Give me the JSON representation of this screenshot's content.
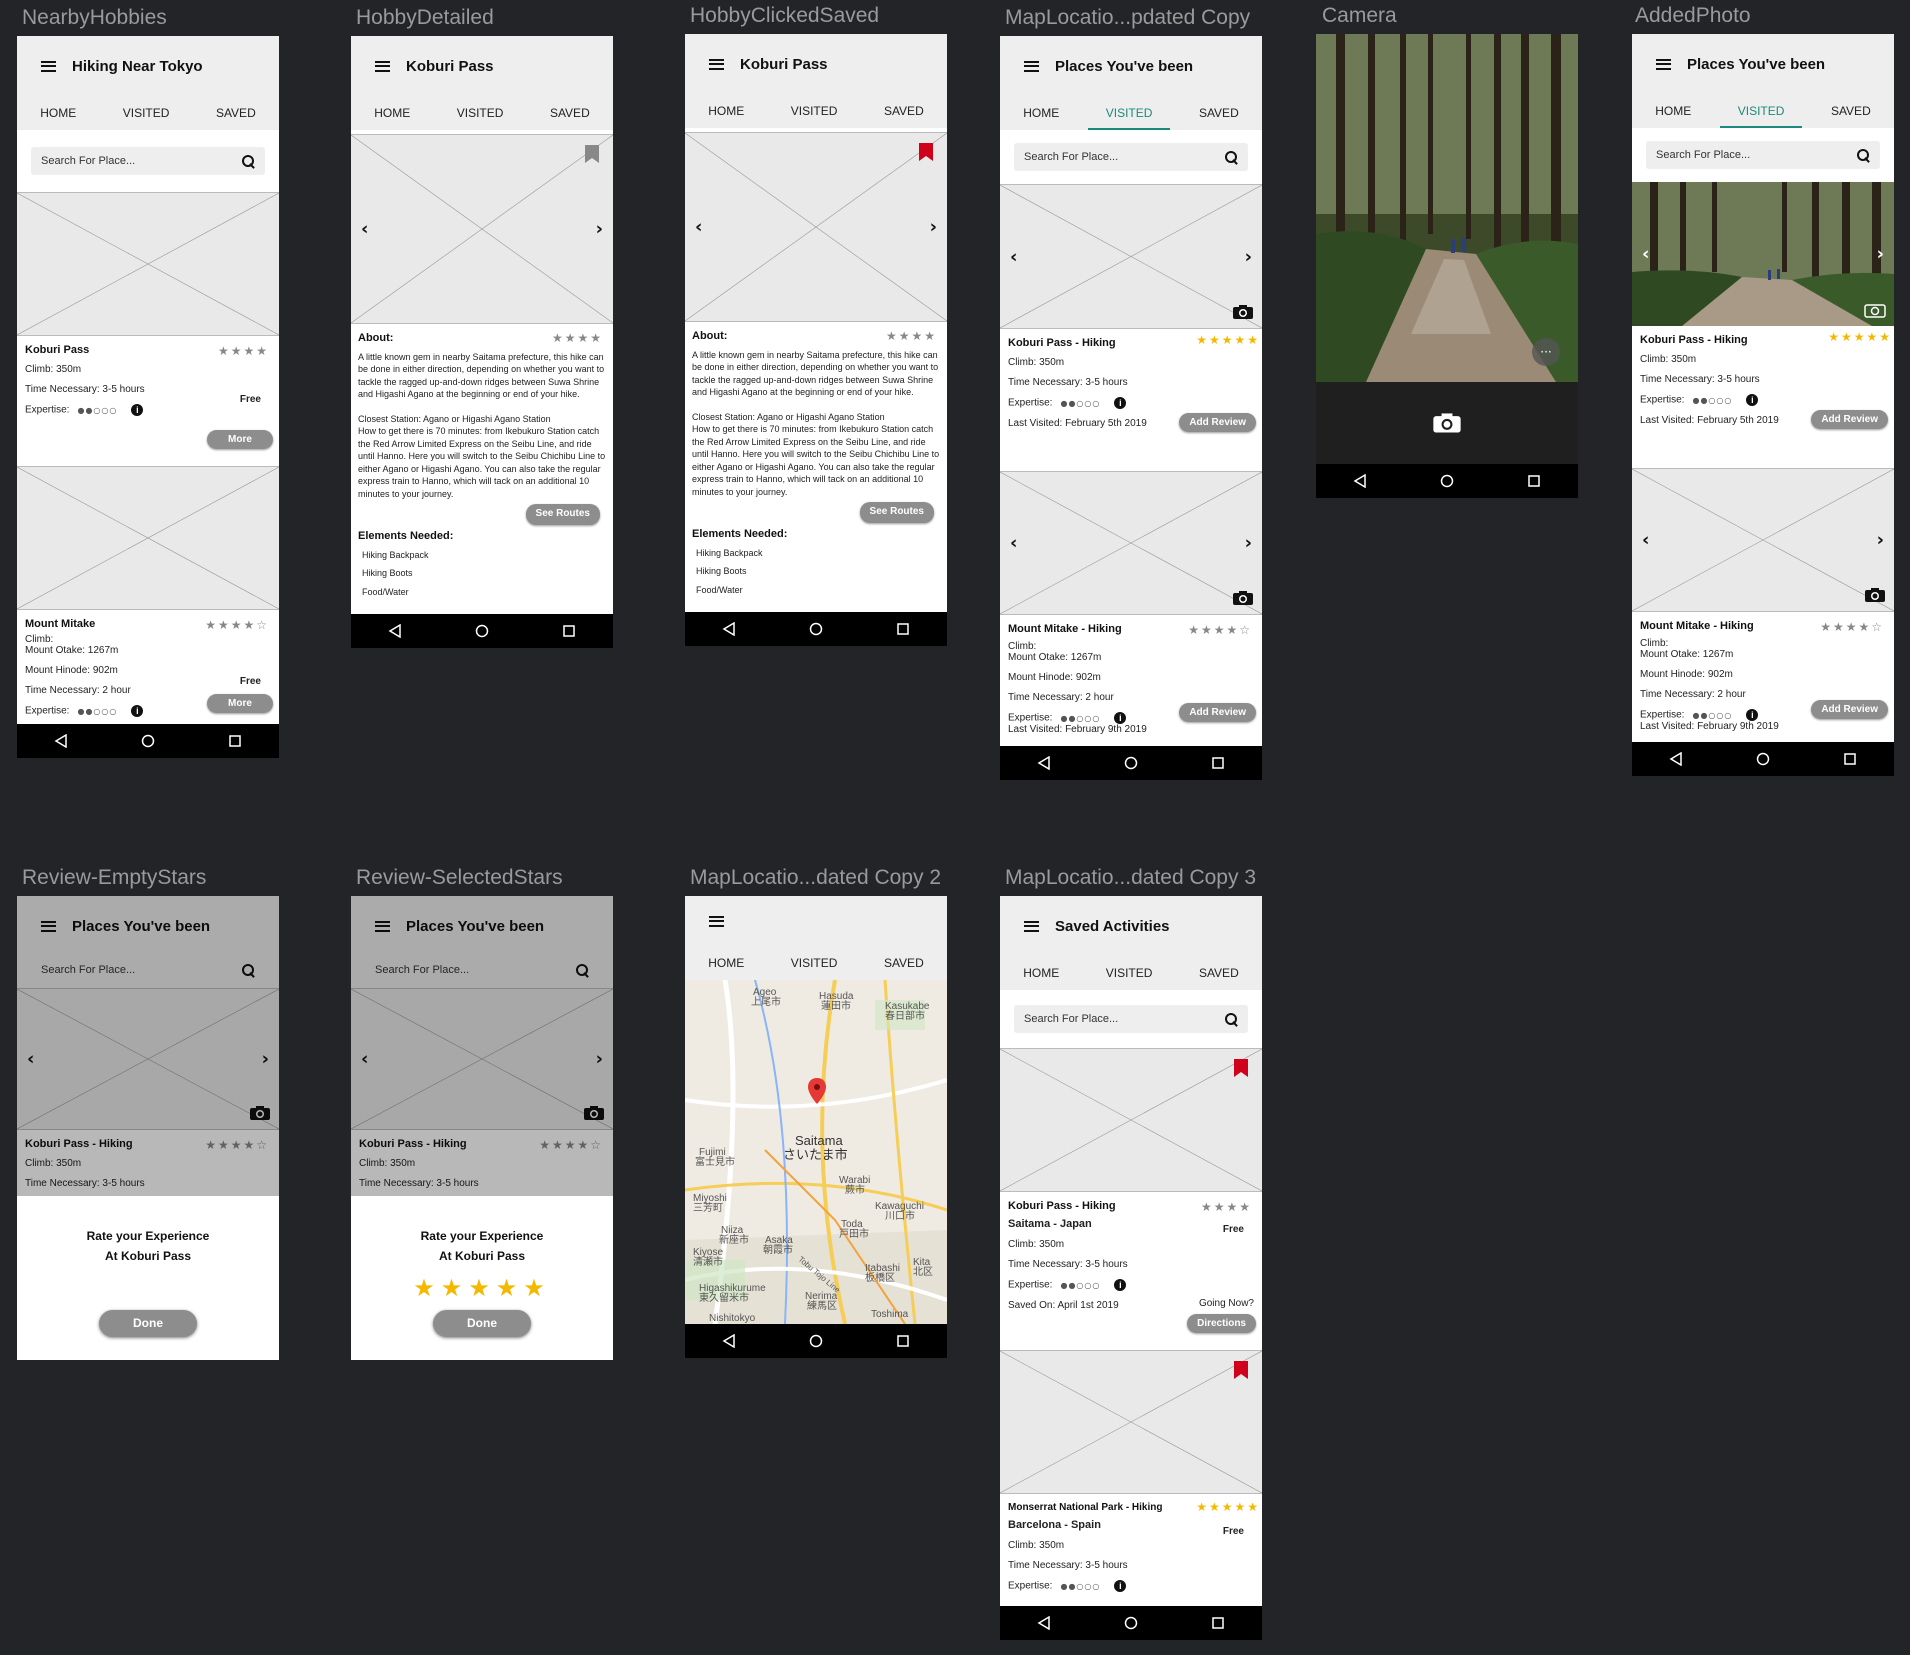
{
  "frames": {
    "f1": "NearbyHobbies",
    "f2": "HobbyDetailed",
    "f3": "HobbyClickedSaved",
    "f4": "MapLocatio...pdated Copy",
    "f5": "Camera",
    "f6": "AddedPhoto",
    "f7": "Review-EmptyStars",
    "f8": "Review-SelectedStars",
    "f9": "MapLocatio...dated Copy 2",
    "f10": "MapLocatio...dated Copy 3"
  },
  "tabs": {
    "home": "HOME",
    "visited": "VISITED",
    "saved": "SAVED"
  },
  "search": {
    "placeholder": "Search For Place..."
  },
  "colors": {
    "accent": "#1c8a7a",
    "star": "#f5b800",
    "bookmark_saved": "#d0021b",
    "pill": "#8d8d8d"
  },
  "nearby": {
    "title": "Hiking Near Tokyo",
    "card1": {
      "name": "Koburi Pass",
      "stars": "★★★★",
      "climb": "Climb: 350m",
      "time": "Time Necessary: 3-5 hours",
      "price": "Free",
      "expertise": "Expertise:",
      "more": "More"
    },
    "card2": {
      "name": "Mount Mitake",
      "stars": "★★★★☆",
      "climb": "Climb:",
      "otake": "Mount Otake: 1267m",
      "hinode": "Mount Hinode: 902m",
      "time": "Time Necessary: 2 hour",
      "price": "Free",
      "expertise": "Expertise:",
      "more": "More"
    }
  },
  "detail": {
    "title": "Koburi Pass",
    "about": "About:",
    "stars": "★★★★",
    "para1": "A little known gem in nearby Saitama prefecture, this hike can be done in either direction, depending on whether you want to tackle the ragged up-and-down ridges between Suwa Shrine and Higashi Agano at the beginning or end of your hike.",
    "para2": "Closest Station: Agano or Higashi Agano Station",
    "para3": "How to get there is 70 minutes: from Ikebukuro Station catch the Red Arrow Limited Express on the Seibu Line, and ride until Hanno. Here you will switch to the Seibu Chichibu Line to either Agano or Higashi Agano. You can also take the regular express train to Hanno, which will tack on an additional 10 minutes to your journey.",
    "routes": "See Routes",
    "elements": "Elements Needed:",
    "items": [
      "Hiking Backpack",
      "Hiking Boots",
      "Food/Water"
    ]
  },
  "visited": {
    "title": "Places You've been",
    "card1": {
      "name": "Koburi Pass - Hiking",
      "stars": "★★★★★",
      "climb": "Climb: 350m",
      "time": "Time Necessary: 3-5 hours",
      "expertise": "Expertise:",
      "last": "Last Visited: February 5th 2019",
      "review": "Add Review"
    },
    "card2": {
      "name": "Mount Mitake - Hiking",
      "stars": "★★★★☆",
      "climb": "Climb:",
      "otake": "Mount Otake: 1267m",
      "hinode": "Mount Hinode: 902m",
      "time": "Time Necessary: 2 hour",
      "expertise": "Expertise:",
      "last": "Last Visited: February 9th 2019",
      "review": "Add Review"
    }
  },
  "review": {
    "card_name": "Koburi Pass - Hiking",
    "card_stars": "★★★★☆",
    "climb": "Climb: 350m",
    "time": "Time Necessary: 3-5 hours",
    "line1": "Rate your Experience",
    "line2": "At Koburi Pass",
    "selected_stars": "★★★★★",
    "done": "Done"
  },
  "map": {
    "labels": [
      "Ageo",
      "上尾市",
      "Hasuda",
      "蓮田市",
      "Kasukabe",
      "春日部市",
      "Saitama",
      "さいたま市",
      "Fujimi",
      "富士見市",
      "Warabi",
      "蕨市",
      "Kawaguchi",
      "川口市",
      "Miyoshi",
      "三芳町",
      "Toda",
      "戸田市",
      "Niiza",
      "新座市",
      "Asaka",
      "朝霞市",
      "Kiyose",
      "清瀬市",
      "Itabashi",
      "板橋区",
      "Kita",
      "北区",
      "Higashikurume",
      "東久留米市",
      "Nerima",
      "練馬区",
      "Toshima",
      "Nishitokyo",
      "Tobu Tojo Line"
    ]
  },
  "saved": {
    "title": "Saved Activities",
    "card1": {
      "name": "Koburi Pass - Hiking",
      "stars": "★★★★",
      "place": "Saitama - Japan",
      "price": "Free",
      "climb": "Climb: 350m",
      "time": "Time Necessary: 3-5 hours",
      "expertise": "Expertise:",
      "going": "Going Now?",
      "saved_on": "Saved On: April 1st 2019",
      "directions": "Directions"
    },
    "card2": {
      "name": "Monserrat National Park - Hiking",
      "stars": "★★★★★",
      "place": "Barcelona - Spain",
      "price": "Free",
      "climb": "Climb: 350m",
      "time": "Time Necessary: 3-5 hours",
      "expertise": "Expertise:"
    }
  },
  "icons": [
    "hamburger-icon",
    "search-icon",
    "bookmark-icon",
    "camera-icon",
    "back-icon",
    "home-icon",
    "recents-icon",
    "info-icon",
    "map-pin-icon",
    "chevron-left-icon",
    "chevron-right-icon"
  ]
}
